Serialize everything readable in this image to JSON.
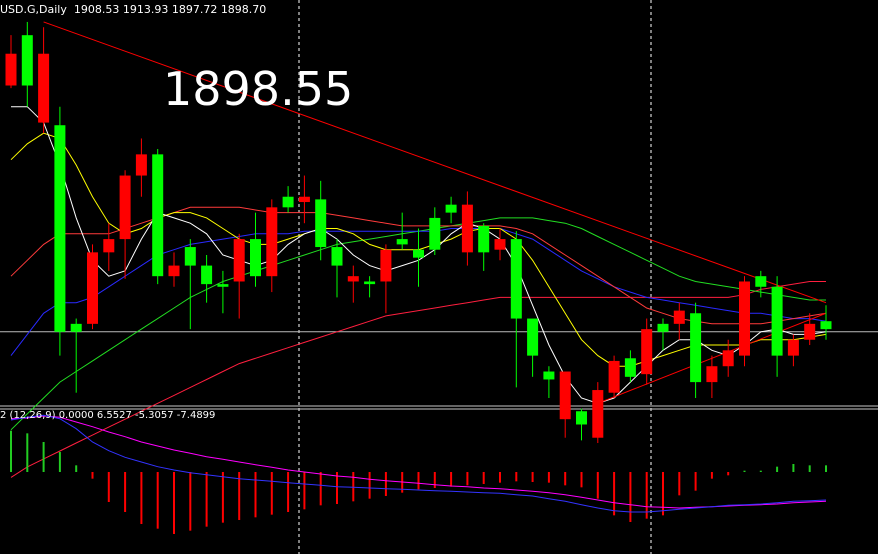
{
  "header": {
    "symbol": "USD.G,Daily",
    "ohlc": "1908.53 1913.93 1897.72 1898.70"
  },
  "price_label": "1898.55",
  "macd_header": "2 (12,26,9) 0.0000 6.5527 -5.3057 -7.4899",
  "colors": {
    "bull": "#00ff00",
    "bear": "#ff0000",
    "ma_fast": "#ffffff",
    "ma_yellow": "#ffff00",
    "ma_red": "#ff3b3b",
    "ma_blue": "#2a2aff",
    "ma_green": "#22dd22",
    "ma_long": "#ff1f3f",
    "trendline": "#ff0000",
    "macd_signal": "#ff00ff",
    "macd_line": "#3333ff",
    "grid": "#ffffff"
  },
  "chart_data": {
    "type": "candlestick",
    "price_range": [
      1820,
      1965
    ],
    "candles": [
      {
        "o": 1950,
        "h": 1957,
        "l": 1937,
        "c": 1938,
        "d": "bear"
      },
      {
        "o": 1938,
        "h": 1962,
        "l": 1930,
        "c": 1957,
        "d": "bull"
      },
      {
        "o": 1950,
        "h": 1960,
        "l": 1920,
        "c": 1924,
        "d": "bear"
      },
      {
        "o": 1923,
        "h": 1930,
        "l": 1836,
        "c": 1845,
        "d": "bull"
      },
      {
        "o": 1845,
        "h": 1850,
        "l": 1822,
        "c": 1848,
        "d": "bull"
      },
      {
        "o": 1848,
        "h": 1878,
        "l": 1846,
        "c": 1875,
        "d": "bear"
      },
      {
        "o": 1875,
        "h": 1886,
        "l": 1868,
        "c": 1880,
        "d": "bear"
      },
      {
        "o": 1880,
        "h": 1906,
        "l": 1865,
        "c": 1904,
        "d": "bear"
      },
      {
        "o": 1904,
        "h": 1918,
        "l": 1896,
        "c": 1912,
        "d": "bear"
      },
      {
        "o": 1912,
        "h": 1914,
        "l": 1863,
        "c": 1866,
        "d": "bull"
      },
      {
        "o": 1866,
        "h": 1875,
        "l": 1862,
        "c": 1870,
        "d": "bear"
      },
      {
        "o": 1870,
        "h": 1880,
        "l": 1846,
        "c": 1877,
        "d": "bull"
      },
      {
        "o": 1870,
        "h": 1874,
        "l": 1856,
        "c": 1863,
        "d": "bull"
      },
      {
        "o": 1863,
        "h": 1868,
        "l": 1852,
        "c": 1862,
        "d": "bull"
      },
      {
        "o": 1864,
        "h": 1882,
        "l": 1850,
        "c": 1880,
        "d": "bear"
      },
      {
        "o": 1880,
        "h": 1890,
        "l": 1862,
        "c": 1866,
        "d": "bull"
      },
      {
        "o": 1866,
        "h": 1895,
        "l": 1860,
        "c": 1892,
        "d": "bear"
      },
      {
        "o": 1892,
        "h": 1900,
        "l": 1890,
        "c": 1896,
        "d": "bull"
      },
      {
        "o": 1896,
        "h": 1904,
        "l": 1886,
        "c": 1894,
        "d": "bear"
      },
      {
        "o": 1895,
        "h": 1902,
        "l": 1872,
        "c": 1877,
        "d": "bull"
      },
      {
        "o": 1877,
        "h": 1880,
        "l": 1858,
        "c": 1870,
        "d": "bull"
      },
      {
        "o": 1866,
        "h": 1870,
        "l": 1856,
        "c": 1864,
        "d": "bear"
      },
      {
        "o": 1864,
        "h": 1866,
        "l": 1858,
        "c": 1863,
        "d": "bull"
      },
      {
        "o": 1864,
        "h": 1878,
        "l": 1852,
        "c": 1876,
        "d": "bear"
      },
      {
        "o": 1878,
        "h": 1890,
        "l": 1876,
        "c": 1880,
        "d": "bull"
      },
      {
        "o": 1873,
        "h": 1884,
        "l": 1862,
        "c": 1876,
        "d": "bull"
      },
      {
        "o": 1876,
        "h": 1892,
        "l": 1874,
        "c": 1888,
        "d": "bull"
      },
      {
        "o": 1890,
        "h": 1896,
        "l": 1886,
        "c": 1893,
        "d": "bull"
      },
      {
        "o": 1893,
        "h": 1898,
        "l": 1870,
        "c": 1875,
        "d": "bear"
      },
      {
        "o": 1875,
        "h": 1886,
        "l": 1868,
        "c": 1885,
        "d": "bull"
      },
      {
        "o": 1880,
        "h": 1884,
        "l": 1872,
        "c": 1876,
        "d": "bear"
      },
      {
        "o": 1880,
        "h": 1883,
        "l": 1824,
        "c": 1850,
        "d": "bull"
      },
      {
        "o": 1850,
        "h": 1848,
        "l": 1828,
        "c": 1836,
        "d": "bull"
      },
      {
        "o": 1830,
        "h": 1832,
        "l": 1820,
        "c": 1827,
        "d": "bull"
      },
      {
        "o": 1830,
        "h": 1815,
        "l": 1805,
        "c": 1812,
        "d": "bear"
      },
      {
        "o": 1815,
        "h": 1816,
        "l": 1804,
        "c": 1810,
        "d": "bull"
      },
      {
        "o": 1805,
        "h": 1826,
        "l": 1803,
        "c": 1823,
        "d": "bear"
      },
      {
        "o": 1822,
        "h": 1836,
        "l": 1820,
        "c": 1834,
        "d": "bear"
      },
      {
        "o": 1835,
        "h": 1838,
        "l": 1826,
        "c": 1828,
        "d": "bull"
      },
      {
        "o": 1829,
        "h": 1850,
        "l": 1825,
        "c": 1846,
        "d": "bear"
      },
      {
        "o": 1845,
        "h": 1850,
        "l": 1838,
        "c": 1848,
        "d": "bull"
      },
      {
        "o": 1848,
        "h": 1856,
        "l": 1842,
        "c": 1853,
        "d": "bear"
      },
      {
        "o": 1852,
        "h": 1856,
        "l": 1820,
        "c": 1826,
        "d": "bull"
      },
      {
        "o": 1826,
        "h": 1836,
        "l": 1820,
        "c": 1832,
        "d": "bear"
      },
      {
        "o": 1832,
        "h": 1842,
        "l": 1828,
        "c": 1838,
        "d": "bear"
      },
      {
        "o": 1836,
        "h": 1866,
        "l": 1832,
        "c": 1864,
        "d": "bear"
      },
      {
        "o": 1866,
        "h": 1868,
        "l": 1858,
        "c": 1862,
        "d": "bull"
      },
      {
        "o": 1862,
        "h": 1866,
        "l": 1828,
        "c": 1836,
        "d": "bull"
      },
      {
        "o": 1836,
        "h": 1844,
        "l": 1832,
        "c": 1842,
        "d": "bear"
      },
      {
        "o": 1842,
        "h": 1852,
        "l": 1840,
        "c": 1848,
        "d": "bear"
      },
      {
        "o": 1849,
        "h": 1855,
        "l": 1842,
        "c": 1846,
        "d": "bull"
      }
    ],
    "ma_fast": [
      1930,
      1930,
      1924,
      1908,
      1888,
      1872,
      1866,
      1868,
      1880,
      1890,
      1888,
      1886,
      1882,
      1874,
      1872,
      1870,
      1872,
      1878,
      1882,
      1884,
      1880,
      1874,
      1870,
      1868,
      1870,
      1872,
      1876,
      1882,
      1886,
      1884,
      1880,
      1870,
      1855,
      1840,
      1828,
      1820,
      1818,
      1820,
      1826,
      1832,
      1838,
      1842,
      1842,
      1838,
      1836,
      1840,
      1845,
      1846,
      1844,
      1844,
      1845
    ],
    "ma_yellow": [
      1910,
      1916,
      1920,
      1918,
      1908,
      1896,
      1886,
      1882,
      1884,
      1888,
      1890,
      1890,
      1888,
      1884,
      1880,
      1878,
      1878,
      1880,
      1882,
      1884,
      1884,
      1882,
      1878,
      1876,
      1876,
      1876,
      1878,
      1880,
      1883,
      1884,
      1884,
      1880,
      1872,
      1862,
      1852,
      1842,
      1836,
      1832,
      1832,
      1834,
      1836,
      1838,
      1840,
      1840,
      1840,
      1840,
      1842,
      1842,
      1842,
      1843,
      1844
    ],
    "ma_red": [
      1866,
      1872,
      1878,
      1882,
      1882,
      1882,
      1882,
      1884,
      1886,
      1888,
      1890,
      1892,
      1892,
      1892,
      1892,
      1891,
      1890,
      1890,
      1890,
      1890,
      1889,
      1888,
      1887,
      1886,
      1885,
      1885,
      1885,
      1885,
      1885,
      1885,
      1885,
      1884,
      1882,
      1878,
      1874,
      1870,
      1866,
      1862,
      1858,
      1854,
      1852,
      1850,
      1849,
      1848,
      1848,
      1848,
      1848,
      1849,
      1850,
      1851,
      1852
    ],
    "ma_blue": [
      1836,
      1844,
      1852,
      1856,
      1856,
      1858,
      1862,
      1866,
      1870,
      1874,
      1876,
      1878,
      1879,
      1880,
      1881,
      1882,
      1882,
      1882,
      1883,
      1883,
      1883,
      1883,
      1883,
      1883,
      1883,
      1883,
      1883,
      1884,
      1884,
      1884,
      1884,
      1882,
      1880,
      1876,
      1872,
      1868,
      1865,
      1862,
      1860,
      1858,
      1857,
      1856,
      1855,
      1854,
      1853,
      1852,
      1852,
      1851,
      1850,
      1850,
      1849
    ],
    "ma_green": [
      1808,
      1814,
      1820,
      1826,
      1830,
      1834,
      1838,
      1842,
      1846,
      1850,
      1854,
      1858,
      1861,
      1864,
      1866,
      1868,
      1870,
      1872,
      1874,
      1876,
      1878,
      1879,
      1880,
      1881,
      1882,
      1883,
      1884,
      1885,
      1886,
      1887,
      1888,
      1888,
      1888,
      1887,
      1886,
      1884,
      1881,
      1878,
      1875,
      1872,
      1869,
      1866,
      1864,
      1863,
      1862,
      1861,
      1860,
      1859,
      1858,
      1857,
      1857
    ],
    "ma_long": [
      1790,
      1794,
      1797,
      1800,
      1803,
      1806,
      1809,
      1812,
      1815,
      1818,
      1821,
      1824,
      1827,
      1830,
      1833,
      1835,
      1837,
      1839,
      1841,
      1843,
      1845,
      1847,
      1849,
      1851,
      1852,
      1853,
      1854,
      1855,
      1856,
      1857,
      1858,
      1858,
      1858,
      1858,
      1858,
      1858,
      1858,
      1858,
      1858,
      1858,
      1858,
      1858,
      1858,
      1858,
      1858,
      1859,
      1861,
      1862,
      1863,
      1864,
      1864
    ],
    "trendlines": [
      {
        "from": [
          2,
          1962
        ],
        "to": [
          50,
          1856
        ]
      },
      {
        "from": [
          36,
          1818
        ],
        "to": [
          50,
          1852
        ]
      }
    ],
    "current_price": 1845,
    "macd": {
      "range": [
        -12,
        9
      ],
      "histogram": [
        6.2,
        5.8,
        4.5,
        3.0,
        1.0,
        -1.0,
        -4.5,
        -6.0,
        -7.8,
        -8.5,
        -9.3,
        -8.8,
        -8.2,
        -7.6,
        -7.2,
        -6.8,
        -6.4,
        -6.0,
        -5.6,
        -5.0,
        -4.8,
        -4.4,
        -4.0,
        -3.6,
        -3.1,
        -2.6,
        -2.4,
        -2.2,
        -2.0,
        -1.8,
        -1.6,
        -1.4,
        -1.5,
        -1.6,
        -2.0,
        -2.3,
        -4.0,
        -6.5,
        -7.5,
        -7.0,
        -6.5,
        -3.5,
        -2.8,
        -1.0,
        -0.5,
        0.2,
        0.2,
        0.8,
        1.2,
        1.0,
        1.0
      ],
      "signal": [
        8.0,
        8.1,
        8.4,
        8.2,
        7.5,
        6.8,
        6.0,
        5.3,
        4.5,
        3.9,
        3.3,
        2.8,
        2.3,
        1.9,
        1.5,
        1.1,
        0.7,
        0.3,
        0.0,
        -0.3,
        -0.6,
        -0.8,
        -1.1,
        -1.3,
        -1.5,
        -1.7,
        -1.9,
        -2.1,
        -2.2,
        -2.4,
        -2.5,
        -2.7,
        -2.9,
        -3.1,
        -3.4,
        -3.8,
        -4.2,
        -4.6,
        -4.9,
        -5.2,
        -5.3,
        -5.4,
        -5.3,
        -5.2,
        -5.1,
        -5.0,
        -4.9,
        -4.8,
        -4.6,
        -4.5,
        -4.4
      ],
      "macd_line": [
        7.8,
        8.2,
        8.5,
        8.0,
        6.5,
        4.5,
        3.2,
        2.2,
        1.5,
        0.8,
        0.3,
        -0.1,
        -0.4,
        -0.7,
        -1.0,
        -1.2,
        -1.4,
        -1.6,
        -1.8,
        -2.0,
        -2.2,
        -2.3,
        -2.4,
        -2.5,
        -2.6,
        -2.7,
        -2.8,
        -2.9,
        -3.0,
        -3.1,
        -3.2,
        -3.4,
        -3.6,
        -4.0,
        -4.4,
        -4.9,
        -5.4,
        -5.8,
        -6.0,
        -6.0,
        -5.8,
        -5.6,
        -5.4,
        -5.2,
        -5.0,
        -4.9,
        -4.8,
        -4.6,
        -4.4,
        -4.3,
        -4.2
      ]
    }
  }
}
